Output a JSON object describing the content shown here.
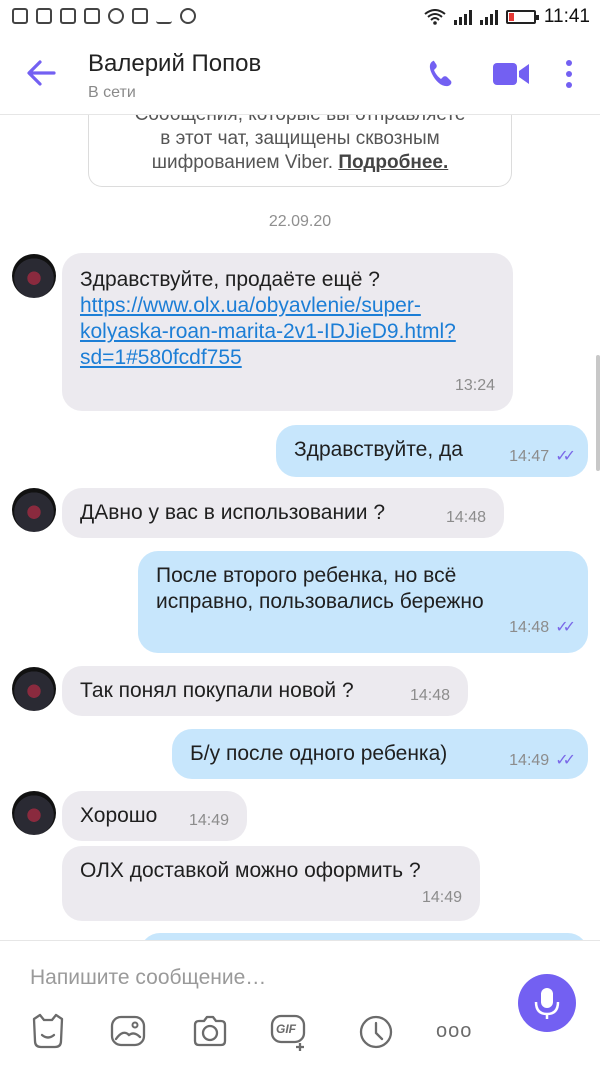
{
  "status_bar": {
    "time": "11:41"
  },
  "header": {
    "title": "Валерий Попов",
    "subtitle": "В сети",
    "icons": [
      "back-arrow-icon",
      "phone-icon",
      "video-icon",
      "more-vertical-icon"
    ]
  },
  "system_notice": {
    "text_lines": [
      "Сообщения, которые вы отправляете",
      "в этот чат, защищены сквозным",
      "шифрованием Viber."
    ],
    "link": "Подробнее."
  },
  "date_separator": "22.09.20",
  "messages": [
    {
      "direction": "in",
      "text": "Здравствуйте, продаёте ещё ?",
      "link_lines": [
        "https://www.olx.ua/obyavlenie/super-",
        "kolyaska-roan-marita-2v1-IDJieD9.html?",
        "sd=1#580fcdf755"
      ],
      "time": "13:24"
    },
    {
      "direction": "out",
      "text": "Здравствуйте, да",
      "time": "14:47"
    },
    {
      "direction": "in",
      "text": "ДАвно у вас в использовании ?",
      "time": "14:48"
    },
    {
      "direction": "out",
      "text_lines": [
        "После второго ребенка, но всё",
        "исправно, пользовались бережно"
      ],
      "time": "14:48"
    },
    {
      "direction": "in",
      "text": "Так понял покупали новой ?",
      "time": "14:48"
    },
    {
      "direction": "out",
      "text": "Б/у после одного ребенка)",
      "time": "14:49"
    },
    {
      "direction": "in",
      "text": "Хорошо",
      "time": "14:49"
    },
    {
      "direction": "in",
      "text": "ОЛХ доставкой можно оформить ?",
      "time": "14:49"
    }
  ],
  "composer": {
    "placeholder": "Напишите сообщение…",
    "tools": [
      "sticker-icon",
      "gallery-icon",
      "camera-icon",
      "gif-icon",
      "timer-icon",
      "more-horizontal-icon"
    ],
    "gif_label": "GIF",
    "more_label": "ooo"
  },
  "colors": {
    "accent": "#7360f2",
    "incoming": "#eceaef",
    "outgoing": "#c7e6fc",
    "link": "#1c7ed6"
  }
}
